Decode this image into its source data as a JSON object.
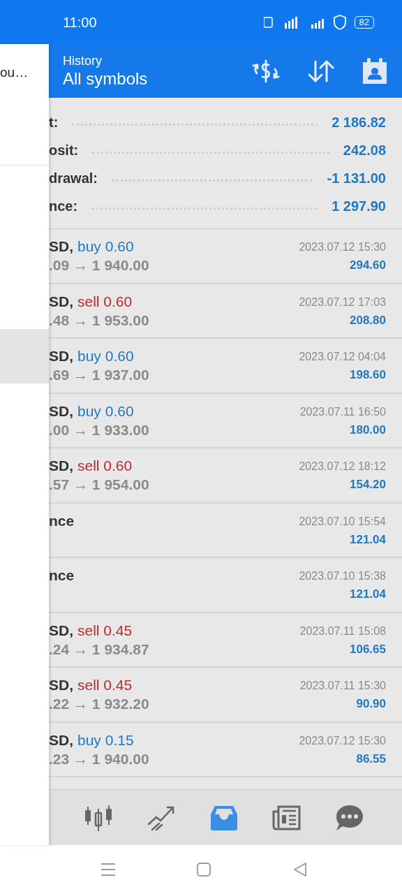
{
  "status_bar": {
    "time": "11:00",
    "battery": "82"
  },
  "drawer": {
    "title": "ou…",
    "items": [
      {
        "selected": false
      },
      {
        "selected": false
      },
      {
        "selected": false
      },
      {
        "selected": true
      }
    ]
  },
  "header": {
    "subtitle": "History",
    "title": "All symbols"
  },
  "summary": [
    {
      "label": "t:",
      "value": "2 186.82"
    },
    {
      "label": "osit:",
      "value": "242.08"
    },
    {
      "label": "drawal:",
      "value": "-1 131.00"
    },
    {
      "label": "nce:",
      "value": "1 297.90"
    }
  ],
  "trades": [
    {
      "kind": "buy",
      "symbol": "SD,",
      "order": "buy 0.60",
      "prices": ".09 → 1 940.00",
      "date": "2023.07.12 15:30",
      "profit": "294.60"
    },
    {
      "kind": "sell",
      "symbol": "SD,",
      "order": "sell 0.60",
      "prices": ".48 → 1 953.00",
      "date": "2023.07.12 17:03",
      "profit": "208.80"
    },
    {
      "kind": "buy",
      "symbol": "SD,",
      "order": "buy 0.60",
      "prices": ".69 → 1 937.00",
      "date": "2023.07.12 04:04",
      "profit": "198.60"
    },
    {
      "kind": "buy",
      "symbol": "SD,",
      "order": "buy 0.60",
      "prices": ".00 → 1 933.00",
      "date": "2023.07.11 16:50",
      "profit": "180.00"
    },
    {
      "kind": "sell",
      "symbol": "SD,",
      "order": "sell 0.60",
      "prices": ".57 → 1 954.00",
      "date": "2023.07.12 18:12",
      "profit": "154.20"
    },
    {
      "kind": "balance",
      "symbol": "nce",
      "date": "2023.07.10 15:54",
      "profit": "121.04"
    },
    {
      "kind": "balance",
      "symbol": "nce",
      "date": "2023.07.10 15:38",
      "profit": "121.04"
    },
    {
      "kind": "sell",
      "symbol": "SD,",
      "order": "sell 0.45",
      "prices": ".24 → 1 934.87",
      "date": "2023.07.11 15:08",
      "profit": "106.65"
    },
    {
      "kind": "sell",
      "symbol": "SD,",
      "order": "sell 0.45",
      "prices": ".22 → 1 932.20",
      "date": "2023.07.11 15:30",
      "profit": "90.90"
    },
    {
      "kind": "buy",
      "symbol": "SD,",
      "order": "buy 0.15",
      "prices": ".23 → 1 940.00",
      "date": "2023.07.12 15:30",
      "profit": "86.55"
    }
  ],
  "bottom_nav": [
    {
      "kind": "chart",
      "selected": false
    },
    {
      "kind": "trade",
      "selected": false
    },
    {
      "kind": "history",
      "selected": true
    },
    {
      "kind": "news",
      "selected": false
    },
    {
      "kind": "chat",
      "selected": false
    }
  ]
}
